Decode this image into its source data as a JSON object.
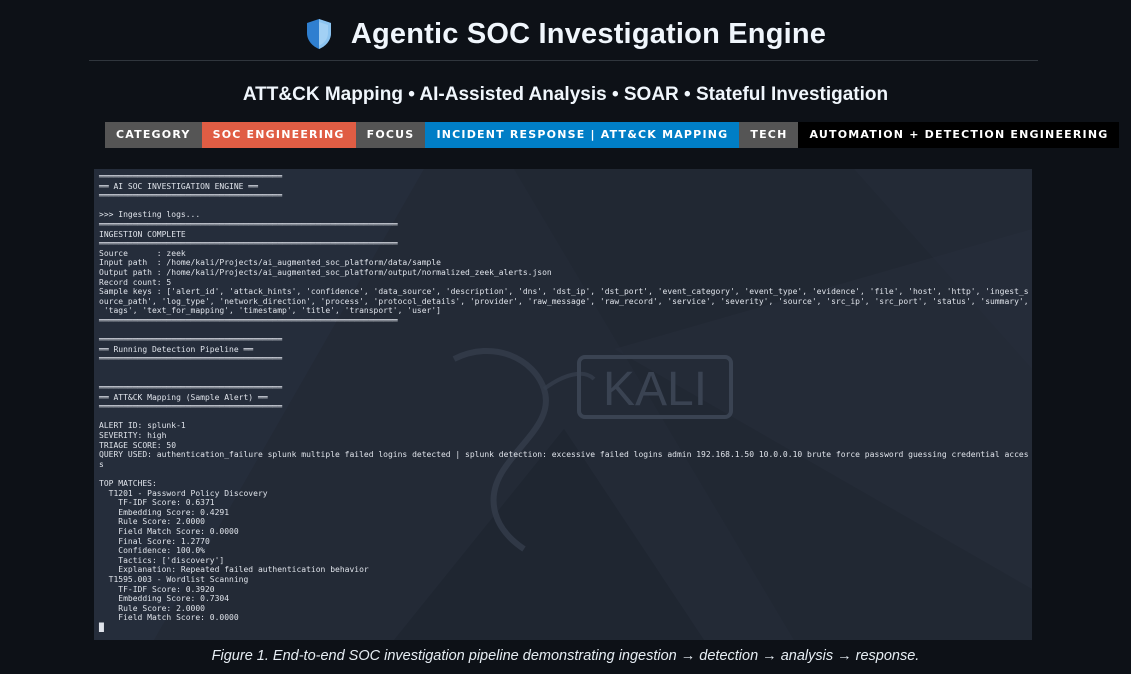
{
  "header": {
    "title": "Agentic SOC Investigation Engine",
    "icon": "shield-icon",
    "subtitle": "ATT&CK Mapping • AI-Assisted Analysis • SOAR • Stateful Investigation"
  },
  "badges": [
    {
      "label": "CATEGORY",
      "color": "#555555"
    },
    {
      "label": "SOC ENGINEERING",
      "color": "#e05d44"
    },
    {
      "label": "FOCUS",
      "color": "#555555"
    },
    {
      "label": "INCIDENT RESPONSE | ATT&CK MAPPING",
      "color": "#007ec6"
    },
    {
      "label": "TECH",
      "color": "#555555"
    },
    {
      "label": "AUTOMATION + DETECTION ENGINEERING",
      "color": "#000000"
    }
  ],
  "terminal": {
    "watermark": "KALI",
    "lines": [
      "══════════════════════════════════════",
      "══ AI SOC INVESTIGATION ENGINE ══",
      "══════════════════════════════════════",
      "",
      ">>> Ingesting logs...",
      "══════════════════════════════════════════════════════════════",
      "INGESTION COMPLETE",
      "══════════════════════════════════════════════════════════════",
      "Source      : zeek",
      "Input path  : /home/kali/Projects/ai_augmented_soc_platform/data/sample",
      "Output path : /home/kali/Projects/ai_augmented_soc_platform/output/normalized_zeek_alerts.json",
      "Record count: 5",
      "Sample keys : ['alert_id', 'attack_hints', 'confidence', 'data_source', 'description', 'dns', 'dst_ip', 'dst_port', 'event_category', 'event_type', 'evidence', 'file', 'host', 'http', 'ingest_s",
      "ource_path', 'log_type', 'network_direction', 'process', 'protocol_details', 'provider', 'raw_message', 'raw_record', 'service', 'severity', 'source', 'src_ip', 'src_port', 'status', 'summary',",
      " 'tags', 'text_for_mapping', 'timestamp', 'title', 'transport', 'user']",
      "══════════════════════════════════════════════════════════════",
      "",
      "══════════════════════════════════════",
      "══ Running Detection Pipeline ══",
      "══════════════════════════════════════",
      "",
      "",
      "══════════════════════════════════════",
      "══ ATT&CK Mapping (Sample Alert) ══",
      "══════════════════════════════════════",
      "",
      "ALERT ID: splunk-1",
      "SEVERITY: high",
      "TRIAGE SCORE: 50",
      "QUERY USED: authentication_failure splunk multiple failed logins detected | splunk detection: excessive failed logins admin 192.168.1.50 10.0.0.10 brute force password guessing credential acces",
      "s",
      "",
      "TOP MATCHES:",
      "  T1201 - Password Policy Discovery",
      "    TF-IDF Score: 0.6371",
      "    Embedding Score: 0.4291",
      "    Rule Score: 2.0000",
      "    Field Match Score: 0.0000",
      "    Final Score: 1.2770",
      "    Confidence: 100.0%",
      "    Tactics: ['discovery']",
      "    Explanation: Repeated failed authentication behavior",
      "  T1595.003 - Wordlist Scanning",
      "    TF-IDF Score: 0.3920",
      "    Embedding Score: 0.7304",
      "    Rule Score: 2.0000",
      "    Field Match Score: 0.0000",
      "█"
    ]
  },
  "caption": "Figure 1. End-to-end SOC investigation pipeline demonstrating ingestion → detection → analysis → response."
}
